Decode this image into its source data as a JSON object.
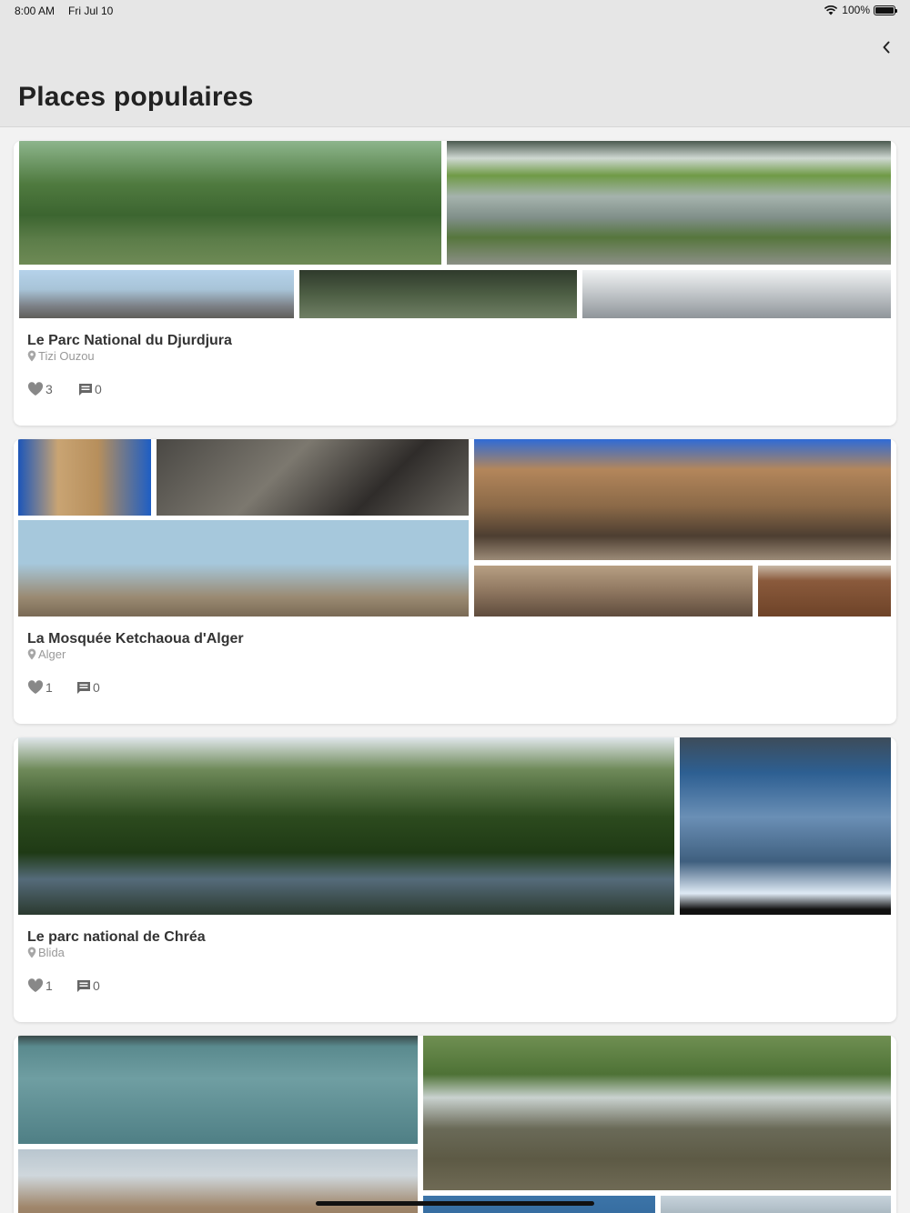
{
  "status_bar": {
    "time": "8:00 AM",
    "date": "Fri Jul 10",
    "battery": "100%"
  },
  "nav": {
    "title": "Places populaires",
    "back_icon": "chevron-left-icon"
  },
  "places": [
    {
      "name": "Le Parc National du Djurdjura",
      "location": "Tizi Ouzou",
      "likes": "3",
      "comments": "0"
    },
    {
      "name": "La Mosquée Ketchaoua d'Alger",
      "location": "Alger",
      "likes": "1",
      "comments": "0"
    },
    {
      "name": "Le parc national de Chréa",
      "location": "Blida",
      "likes": "1",
      "comments": "0"
    },
    {
      "name": "",
      "location": "",
      "likes": "",
      "comments": ""
    }
  ],
  "icons": {
    "like": "heart-icon",
    "comment": "comment-icon",
    "location": "map-pin-icon"
  },
  "colors": {
    "nav_background": "#e6e6e6",
    "page_background": "#f2f2f2",
    "card": "#ffffff",
    "secondary_text": "#999999"
  }
}
